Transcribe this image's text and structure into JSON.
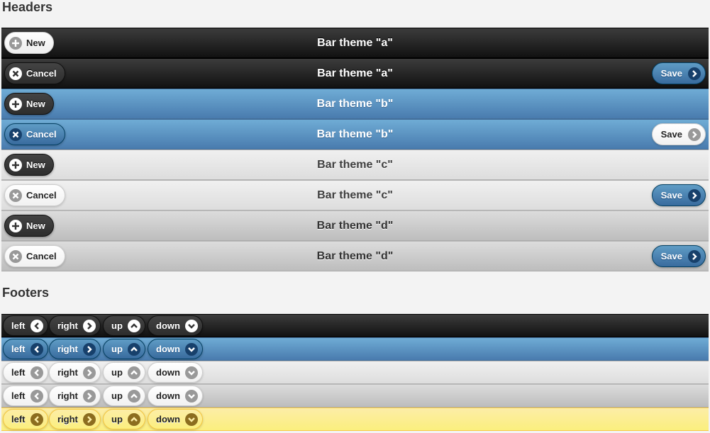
{
  "headers": {
    "title": "Headers",
    "bars": [
      {
        "theme": "a",
        "title": "Bar theme \"a\"",
        "left": {
          "label": "New",
          "icon": "plus-icon"
        },
        "right": null
      },
      {
        "theme": "a",
        "title": "Bar theme \"a\"",
        "left": {
          "label": "Cancel",
          "icon": "close-icon"
        },
        "right": {
          "label": "Save",
          "icon": "arrow-right-icon"
        }
      },
      {
        "theme": "b",
        "title": "Bar theme \"b\"",
        "left": {
          "label": "New",
          "icon": "plus-icon"
        },
        "right": null
      },
      {
        "theme": "b",
        "title": "Bar theme \"b\"",
        "left": {
          "label": "Cancel",
          "icon": "close-icon"
        },
        "right": {
          "label": "Save",
          "icon": "arrow-right-icon"
        }
      },
      {
        "theme": "c",
        "title": "Bar theme \"c\"",
        "left": {
          "label": "New",
          "icon": "plus-icon"
        },
        "right": null
      },
      {
        "theme": "c",
        "title": "Bar theme \"c\"",
        "left": {
          "label": "Cancel",
          "icon": "close-icon"
        },
        "right": {
          "label": "Save",
          "icon": "arrow-right-icon"
        }
      },
      {
        "theme": "d",
        "title": "Bar theme \"d\"",
        "left": {
          "label": "New",
          "icon": "plus-icon"
        },
        "right": null
      },
      {
        "theme": "d",
        "title": "Bar theme \"d\"",
        "left": {
          "label": "Cancel",
          "icon": "close-icon"
        },
        "right": {
          "label": "Save",
          "icon": "arrow-right-icon"
        }
      }
    ]
  },
  "footers": {
    "title": "Footers",
    "buttons": [
      {
        "label": "left",
        "icon": "arrow-left-icon"
      },
      {
        "label": "right",
        "icon": "arrow-right-icon"
      },
      {
        "label": "up",
        "icon": "arrow-up-icon"
      },
      {
        "label": "down",
        "icon": "arrow-down-icon"
      }
    ],
    "themes": [
      "a",
      "b",
      "c",
      "d",
      "e"
    ]
  },
  "colors": {
    "theme_a": "#1d1d1d",
    "theme_b": "#5e97c4",
    "theme_c": "#e9e9e9",
    "theme_d": "#cccccc",
    "theme_e": "#fbef7e"
  }
}
